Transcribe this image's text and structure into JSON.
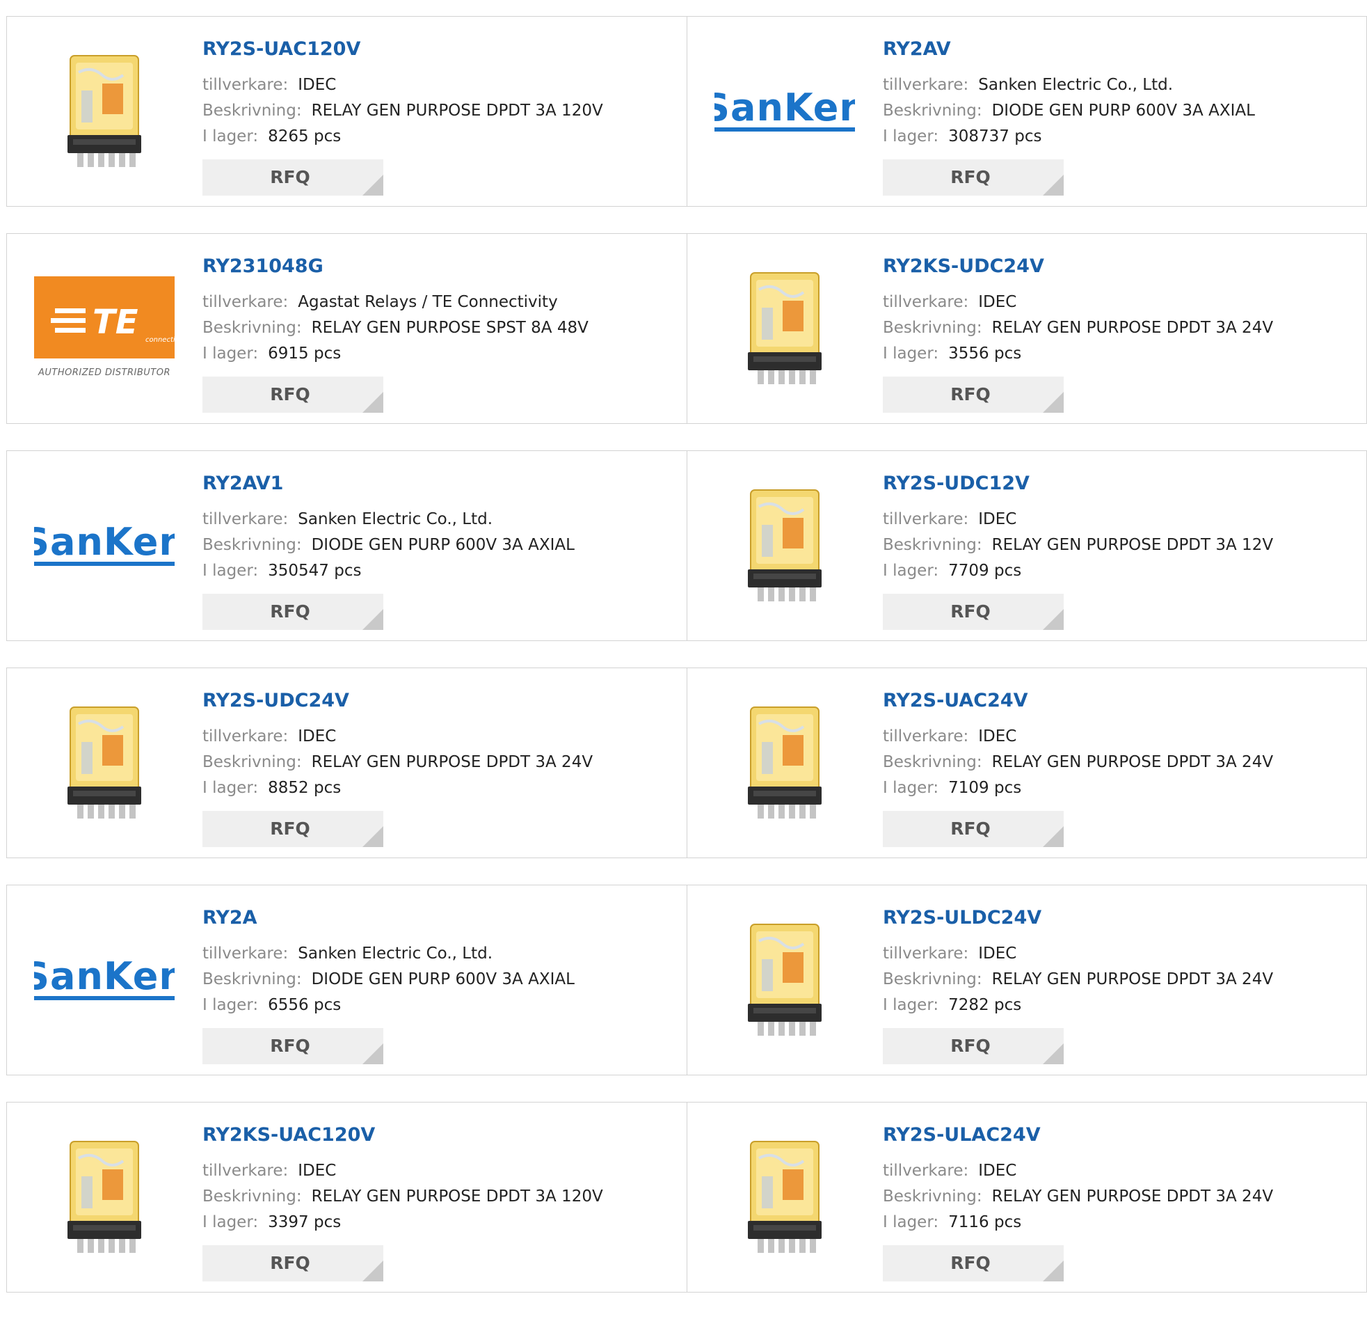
{
  "labels": {
    "manufacturer": "tillverkare:",
    "description": "Beskrivning:",
    "stock": "I lager:",
    "rfq": "RFQ"
  },
  "logos": {
    "sanken": "SanKen",
    "te": "TE",
    "te_sub": "connectivity",
    "te_caption": "AUTHORIZED DISTRIBUTOR"
  },
  "colors": {
    "link": "#1a5fa8",
    "label": "#8a8a8a",
    "sanken": "#1b74c9",
    "te_orange": "#f18a21"
  },
  "products": [
    {
      "part": "RY2S-UAC120V",
      "manufacturer": "IDEC",
      "description": "RELAY GEN PURPOSE DPDT 3A 120V",
      "stock": "8265 pcs",
      "image": "relay-icon"
    },
    {
      "part": "RY2AV",
      "manufacturer": "Sanken Electric Co., Ltd.",
      "description": "DIODE GEN PURP 600V 3A AXIAL",
      "stock": "308737 pcs",
      "image": "sanken-logo"
    },
    {
      "part": "RY231048G",
      "manufacturer": "Agastat Relays / TE Connectivity",
      "description": "RELAY GEN PURPOSE SPST 8A 48V",
      "stock": "6915 pcs",
      "image": "te-logo"
    },
    {
      "part": "RY2KS-UDC24V",
      "manufacturer": "IDEC",
      "description": "RELAY GEN PURPOSE DPDT 3A 24V",
      "stock": "3556 pcs",
      "image": "relay-icon"
    },
    {
      "part": "RY2AV1",
      "manufacturer": "Sanken Electric Co., Ltd.",
      "description": "DIODE GEN PURP 600V 3A AXIAL",
      "stock": "350547 pcs",
      "image": "sanken-logo"
    },
    {
      "part": "RY2S-UDC12V",
      "manufacturer": "IDEC",
      "description": "RELAY GEN PURPOSE DPDT 3A 12V",
      "stock": "7709 pcs",
      "image": "relay-icon"
    },
    {
      "part": "RY2S-UDC24V",
      "manufacturer": "IDEC",
      "description": "RELAY GEN PURPOSE DPDT 3A 24V",
      "stock": "8852 pcs",
      "image": "relay-icon"
    },
    {
      "part": "RY2S-UAC24V",
      "manufacturer": "IDEC",
      "description": "RELAY GEN PURPOSE DPDT 3A 24V",
      "stock": "7109 pcs",
      "image": "relay-icon"
    },
    {
      "part": "RY2A",
      "manufacturer": "Sanken Electric Co., Ltd.",
      "description": "DIODE GEN PURP 600V 3A AXIAL",
      "stock": "6556 pcs",
      "image": "sanken-logo"
    },
    {
      "part": "RY2S-ULDC24V",
      "manufacturer": "IDEC",
      "description": "RELAY GEN PURPOSE DPDT 3A 24V",
      "stock": "7282 pcs",
      "image": "relay-icon"
    },
    {
      "part": "RY2KS-UAC120V",
      "manufacturer": "IDEC",
      "description": "RELAY GEN PURPOSE DPDT 3A 120V",
      "stock": "3397 pcs",
      "image": "relay-icon"
    },
    {
      "part": "RY2S-ULAC24V",
      "manufacturer": "IDEC",
      "description": "RELAY GEN PURPOSE DPDT 3A 24V",
      "stock": "7116 pcs",
      "image": "relay-icon"
    }
  ]
}
